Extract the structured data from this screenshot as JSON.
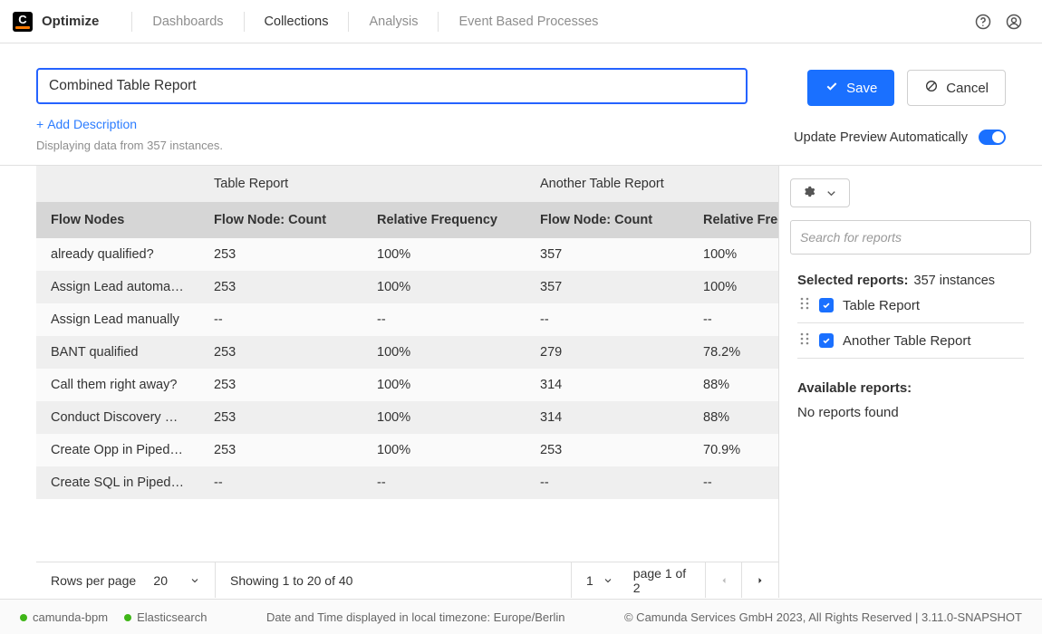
{
  "brand": {
    "logo_letter": "C",
    "title": "Optimize"
  },
  "nav": {
    "items": [
      {
        "label": "Dashboards",
        "active": false
      },
      {
        "label": "Collections",
        "active": true
      },
      {
        "label": "Analysis",
        "active": false
      },
      {
        "label": "Event Based Processes",
        "active": false
      }
    ]
  },
  "editor": {
    "title_value": "Combined Table Report",
    "add_description": "Add Description",
    "subinfo": "Displaying data from 357 instances.",
    "save_label": "Save",
    "cancel_label": "Cancel",
    "auto_update_label": "Update Preview Automatically",
    "auto_update_on": true
  },
  "table": {
    "group_headers": [
      "",
      "Table Report",
      "",
      "Another Table Report",
      ""
    ],
    "columns": [
      "Flow Nodes",
      "Flow Node: Count",
      "Relative Frequency",
      "Flow Node: Count",
      "Relative Frequency"
    ],
    "rows": [
      {
        "cells": [
          "already qualified?",
          "253",
          "100%",
          "357",
          "100%"
        ]
      },
      {
        "cells": [
          "Assign Lead automat…",
          "253",
          "100%",
          "357",
          "100%"
        ]
      },
      {
        "cells": [
          "Assign Lead manually",
          "--",
          "--",
          "--",
          "--"
        ]
      },
      {
        "cells": [
          "BANT qualified",
          "253",
          "100%",
          "279",
          "78.2%"
        ]
      },
      {
        "cells": [
          "Call them right away?",
          "253",
          "100%",
          "314",
          "88%"
        ]
      },
      {
        "cells": [
          "Conduct Discovery Call",
          "253",
          "100%",
          "314",
          "88%"
        ]
      },
      {
        "cells": [
          "Create Opp in Pipedr…",
          "253",
          "100%",
          "253",
          "70.9%"
        ]
      },
      {
        "cells": [
          "Create SQL in Pipedri…",
          "--",
          "--",
          "--",
          "--"
        ]
      }
    ]
  },
  "pager": {
    "rows_per_page_label": "Rows per page",
    "rows_per_page_value": "20",
    "showing": "Showing 1 to 20 of 40",
    "current_page_value": "1",
    "page_of": "page 1 of 2"
  },
  "side": {
    "search_placeholder": "Search for reports",
    "selected_title": "Selected reports:",
    "selected_sub": "357 instances",
    "selected_reports": [
      {
        "label": "Table Report"
      },
      {
        "label": "Another Table Report"
      }
    ],
    "available_title": "Available reports:",
    "available_empty": "No reports found"
  },
  "footer": {
    "statuses": [
      {
        "label": "camunda-bpm"
      },
      {
        "label": "Elasticsearch"
      }
    ],
    "tz": "Date and Time displayed in local timezone: Europe/Berlin",
    "copyright": "© Camunda Services GmbH 2023, All Rights Reserved | 3.11.0-SNAPSHOT"
  }
}
